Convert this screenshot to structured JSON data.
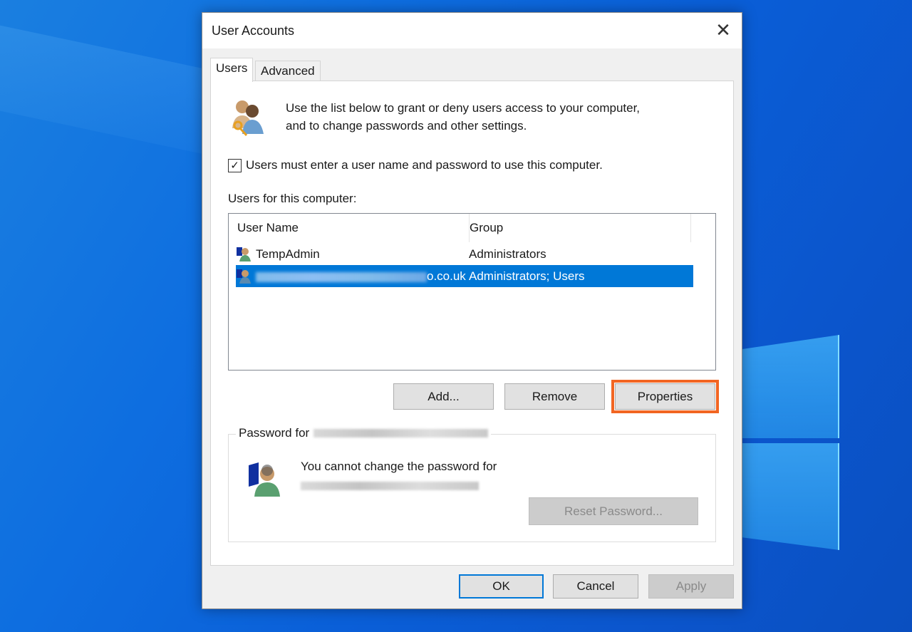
{
  "window": {
    "title": "User Accounts",
    "close_label": "✕"
  },
  "tabs": [
    {
      "label": "Users",
      "active": true
    },
    {
      "label": "Advanced",
      "active": false
    }
  ],
  "users_tab": {
    "intro_line1": "Use the list below to grant or deny users access to your computer,",
    "intro_line2": "and to change passwords and other settings.",
    "require_login_checkbox": {
      "label": "Users must enter a user name and password to use this computer.",
      "checked": true,
      "glyph": "✓"
    },
    "users_label": "Users for this computer:",
    "table": {
      "columns": [
        "User Name",
        "Group"
      ],
      "rows": [
        {
          "user": "TempAdmin",
          "group": "Administrators",
          "selected": false
        },
        {
          "user": "o.co.uk",
          "user_redacted": true,
          "group": "Administrators; Users",
          "selected": true
        }
      ]
    },
    "buttons": {
      "add": "Add...",
      "remove": "Remove",
      "properties": "Properties"
    },
    "password_group": {
      "label": "Password for",
      "message": "You cannot change the password for",
      "reset_button": "Reset Password..."
    }
  },
  "footer": {
    "ok": "OK",
    "cancel": "Cancel",
    "apply": "Apply"
  },
  "colors": {
    "selection": "#0078d7",
    "highlight": "#f26522"
  }
}
